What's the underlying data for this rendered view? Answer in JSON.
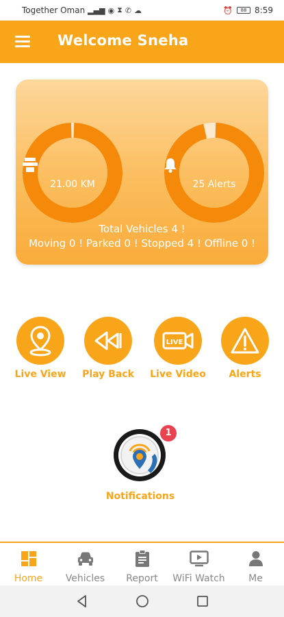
{
  "status_bar": {
    "carrier": "Together Oman",
    "time": "8:59",
    "battery": "88"
  },
  "app_bar": {
    "title": "Welcome Sneha",
    "menu_icon": "hamburger-menu-icon"
  },
  "summary": {
    "distance_label": "21.00 KM",
    "distance_icon": "road-icon",
    "alerts_label": "25 Alerts",
    "alerts_icon": "bell-icon",
    "total_vehicles": "Total Vehicles 4 !",
    "status_line": "Moving 0 !  Parked 0 ! Stopped 4 ! Offline 0 !",
    "distance_gauge_fill": 0.99,
    "alerts_gauge_fill": 0.96,
    "colors": {
      "gauge": "#f58a0a",
      "gauge_track": "#fbe9cf"
    }
  },
  "actions": [
    {
      "label": "Live View",
      "icon": "map-pin-icon"
    },
    {
      "label": "Play Back",
      "icon": "rewind-icon"
    },
    {
      "label": "Live Video",
      "icon": "live-video-icon"
    },
    {
      "label": "Alerts",
      "icon": "warning-icon"
    }
  ],
  "notifications": {
    "label": "Notifications",
    "badge_count": "1",
    "icon": "notifications-logo-icon"
  },
  "bottom_nav": [
    {
      "label": "Home",
      "icon": "home-grid-icon",
      "active": true
    },
    {
      "label": "Vehicles",
      "icon": "car-icon",
      "active": false
    },
    {
      "label": "Report",
      "icon": "clipboard-icon",
      "active": false
    },
    {
      "label": "WiFi Watch",
      "icon": "play-screen-icon",
      "active": false
    },
    {
      "label": "Me",
      "icon": "person-icon",
      "active": false
    }
  ],
  "theme": {
    "accent": "#f8a519",
    "badge": "#e8434e"
  }
}
